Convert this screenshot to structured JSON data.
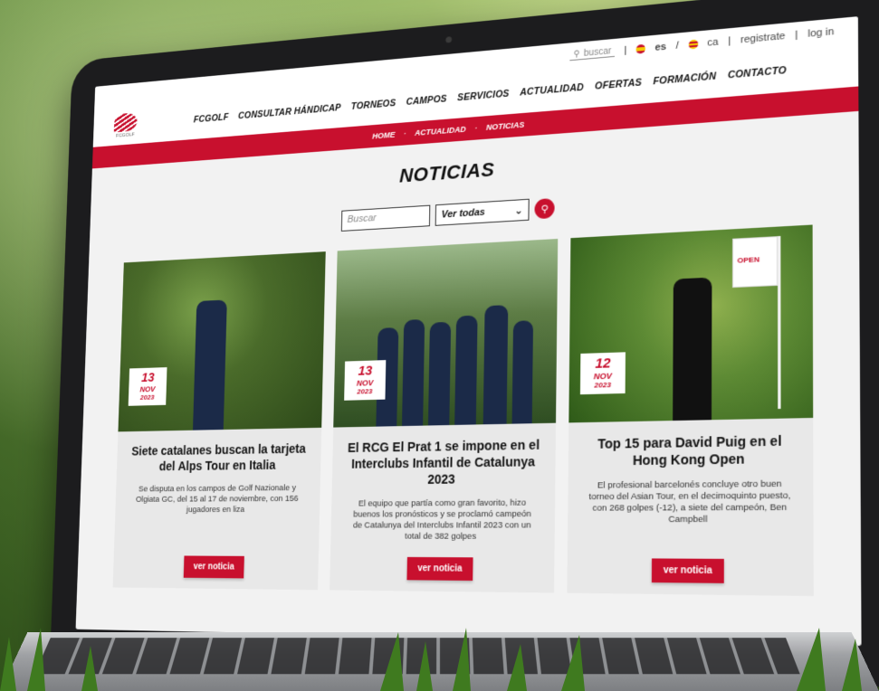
{
  "topbar": {
    "search_placeholder": "buscar",
    "lang_es": "es",
    "lang_ca": "ca",
    "register": "registrate",
    "login": "log in"
  },
  "logo": {
    "text": "FCGOLF"
  },
  "nav": {
    "items": [
      "FCGOLF",
      "CONSULTAR HÁNDICAP",
      "TORNEOS",
      "CAMPOS",
      "SERVICIOS",
      "ACTUALIDAD",
      "OFERTAS",
      "FORMACIÓN",
      "CONTACTO"
    ]
  },
  "breadcrumb": {
    "home": "HOME",
    "section": "ACTUALIDAD",
    "current": "NOTICIAS"
  },
  "page": {
    "title": "NOTICIAS"
  },
  "filters": {
    "search_placeholder": "Buscar",
    "select_value": "Ver todas"
  },
  "cards": [
    {
      "day": "13",
      "month": "NOV",
      "year": "2023",
      "title": "Siete catalanes buscan la tarjeta del Alps Tour en Italia",
      "excerpt": "Se disputa en los campos de Golf Nazionale y Olgiata GC, del 15 al 17 de noviembre, con 156 jugadores en liza",
      "button": "ver noticia"
    },
    {
      "day": "13",
      "month": "NOV",
      "year": "2023",
      "title": "El RCG El Prat 1 se impone en el Interclubs Infantil de Catalunya 2023",
      "excerpt": "El equipo que partía como gran favorito, hizo buenos los pronósticos y se proclamó campeón de Catalunya del Interclubs Infantil 2023 con un total de 382 golpes",
      "button": "ver noticia"
    },
    {
      "day": "12",
      "month": "NOV",
      "year": "2023",
      "title": "Top 15 para David Puig en el Hong Kong Open",
      "excerpt": "El profesional barcelonés concluye otro buen torneo del Asian Tour, en el decimoquinto puesto, con 268 golpes (-12), a siete del campeón, Ben Campbell",
      "button": "ver noticia",
      "flag_text": "OPEN"
    }
  ]
}
